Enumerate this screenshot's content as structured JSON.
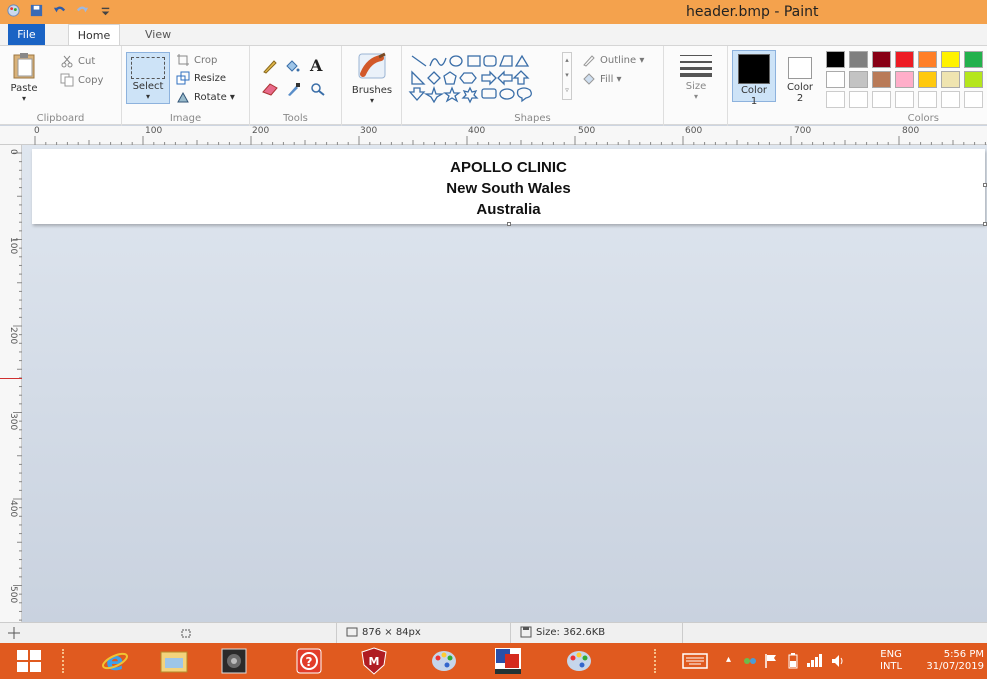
{
  "window": {
    "title": "header.bmp - Paint"
  },
  "tabs": {
    "file": "File",
    "home": "Home",
    "view": "View"
  },
  "clipboard": {
    "label": "Clipboard",
    "paste": "Paste",
    "cut": "Cut",
    "copy": "Copy"
  },
  "image": {
    "label": "Image",
    "select": "Select",
    "crop": "Crop",
    "resize": "Resize",
    "rotate": "Rotate ▾"
  },
  "tools": {
    "label": "Tools"
  },
  "brushes": {
    "label": "Brushes"
  },
  "shapes": {
    "label": "Shapes",
    "outline": "Outline ▾",
    "fill": "Fill ▾"
  },
  "size": {
    "label": "Size"
  },
  "color1": {
    "label": "Color",
    "num": "1"
  },
  "color2": {
    "label": "Color",
    "num": "2"
  },
  "colors": {
    "label": "Colors",
    "row1": [
      "#000000",
      "#7f7f7f",
      "#880015",
      "#ed1c24",
      "#ff7f27",
      "#fff200",
      "#22b14c"
    ],
    "row2": [
      "#ffffff",
      "#c3c3c3",
      "#b97a57",
      "#ffaec9",
      "#ffc90e",
      "#efe4b0",
      "#b5e61d"
    ]
  },
  "ruler": {
    "h": [
      "0",
      "100",
      "200",
      "300",
      "400",
      "500",
      "600",
      "700",
      "800"
    ],
    "v": [
      "0",
      "100",
      "200",
      "300",
      "400",
      "500"
    ]
  },
  "canvas": {
    "line1": "APOLLO CLINIC",
    "line2": "New South Wales",
    "line3": "Australia"
  },
  "status": {
    "dimensions": "876 × 84px",
    "size": "Size: 362.6KB"
  },
  "tray": {
    "lang1": "ENG",
    "lang2": "INTL",
    "time": "5:56 PM",
    "date": "31/07/2019"
  },
  "accent": {
    "titlebar": "#f4a24d",
    "taskbar": "#e05a1f",
    "file_tab": "#1a63c4"
  }
}
